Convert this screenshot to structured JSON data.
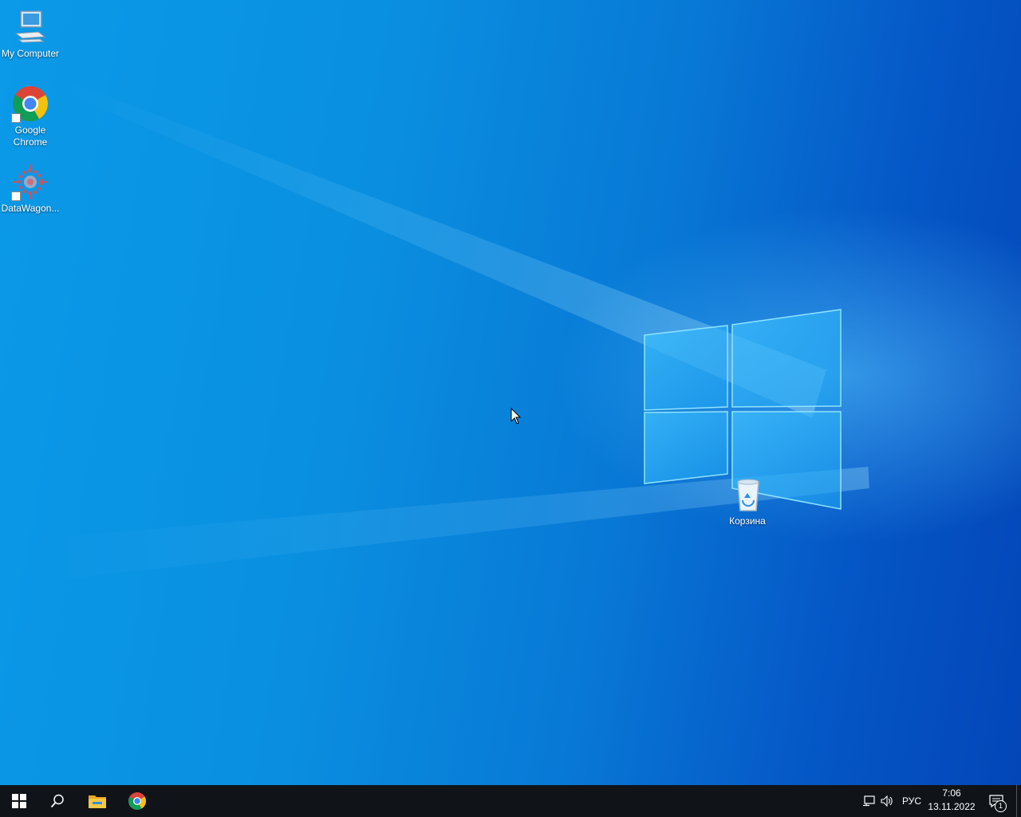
{
  "desktop": {
    "icons": [
      {
        "label": "My Computer",
        "icon": "computer-icon"
      },
      {
        "label": "Google Chrome",
        "icon": "chrome-icon"
      },
      {
        "label": "DataWagon...",
        "icon": "datawagon-icon"
      },
      {
        "label": "Корзина",
        "icon": "recycle-bin-icon"
      }
    ]
  },
  "taskbar": {
    "start": "windows-start-icon",
    "search": "search-icon",
    "pinned": [
      {
        "icon": "file-explorer-icon"
      },
      {
        "icon": "chrome-icon"
      }
    ],
    "tray": {
      "network": "network-icon",
      "volume": "volume-icon",
      "language": "РУС",
      "time": "7:06",
      "date": "13.11.2022",
      "notifications_count": "1"
    }
  },
  "colors": {
    "taskbar": "#101418",
    "wallpaper_accent": "#0a8fe0"
  }
}
